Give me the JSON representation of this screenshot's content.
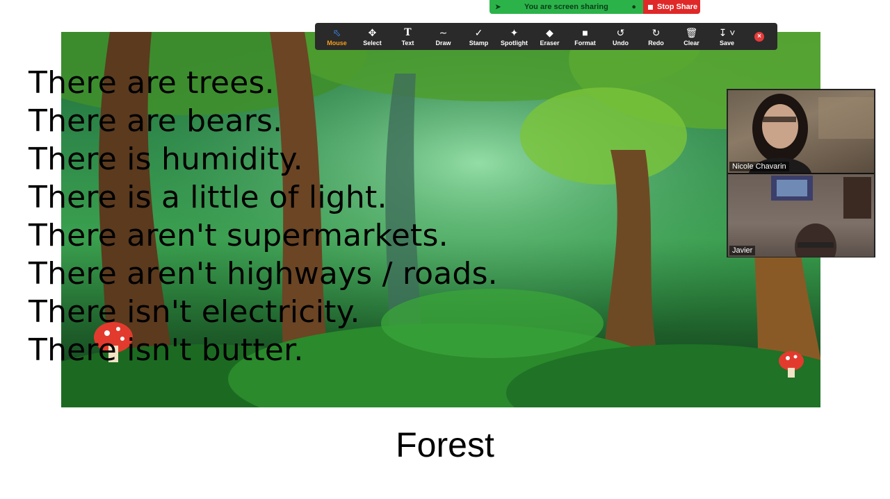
{
  "share_banner": {
    "message": "You are screen sharing",
    "stop_label": "Stop Share"
  },
  "toolbar": {
    "tools": [
      {
        "label": "Mouse",
        "icon": "mouse-pointer-icon",
        "active": true
      },
      {
        "label": "Select",
        "icon": "move-icon"
      },
      {
        "label": "Text",
        "icon": "text-icon"
      },
      {
        "label": "Draw",
        "icon": "draw-wave-icon"
      },
      {
        "label": "Stamp",
        "icon": "check-stamp-icon"
      },
      {
        "label": "Spotlight",
        "icon": "spotlight-wand-icon"
      },
      {
        "label": "Eraser",
        "icon": "eraser-icon"
      },
      {
        "label": "Format",
        "icon": "format-square-icon"
      },
      {
        "label": "Undo",
        "icon": "undo-icon"
      },
      {
        "label": "Redo",
        "icon": "redo-icon"
      },
      {
        "label": "Clear",
        "icon": "trash-icon"
      },
      {
        "label": "Save",
        "icon": "download-icon"
      }
    ]
  },
  "slide": {
    "sentences": [
      "There are trees.",
      "There are bears.",
      "There is humidity.",
      "There is a little of light.",
      "There aren't supermarkets.",
      "There aren't highways / roads.",
      "There isn't electricity.",
      "There isn't butter."
    ],
    "title": "Forest"
  },
  "participants": [
    {
      "name": "Nicole Chavarin"
    },
    {
      "name": "Javier"
    }
  ],
  "colors": {
    "share_green": "#2bb34a",
    "stop_red": "#e02828",
    "toolbar_bg": "#2a2a2a",
    "active_tool": "#f59e1b"
  }
}
